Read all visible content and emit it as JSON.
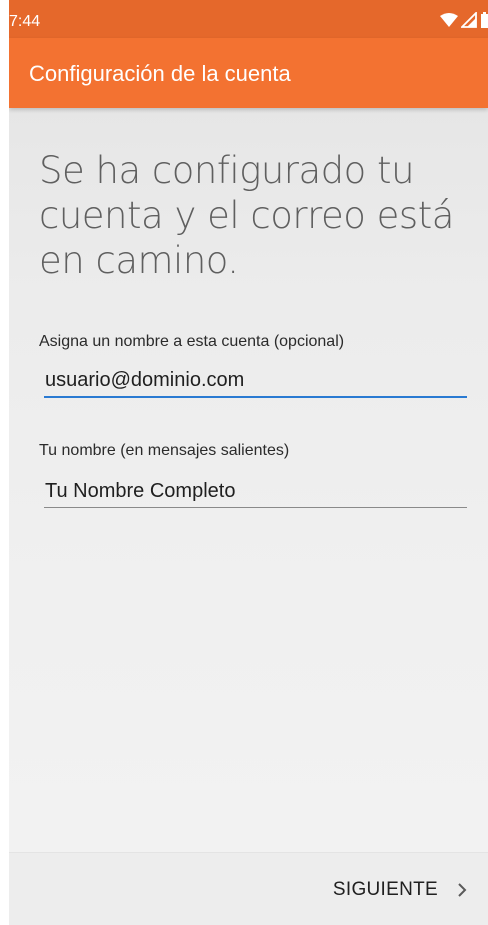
{
  "status_bar": {
    "time": "7:44",
    "icons": [
      "wifi-icon",
      "signal-icon",
      "battery-icon"
    ]
  },
  "app_bar": {
    "title": "Configuración de la cuenta"
  },
  "main": {
    "headline": "Se ha configurado tu cuenta y el correo está en camino.",
    "account_name": {
      "label": "Asigna un nombre a esta cuenta (opcional)",
      "value": "usuario@dominio.com"
    },
    "your_name": {
      "label": "Tu nombre (en mensajes salientes)",
      "value": "Tu Nombre Completo"
    }
  },
  "footer": {
    "next_label": "SIGUIENTE",
    "next_icon": "chevron-right-icon"
  },
  "colors": {
    "status_bar": "#e5682b",
    "app_bar": "#f37231",
    "focus_underline": "#2a7ad2"
  }
}
